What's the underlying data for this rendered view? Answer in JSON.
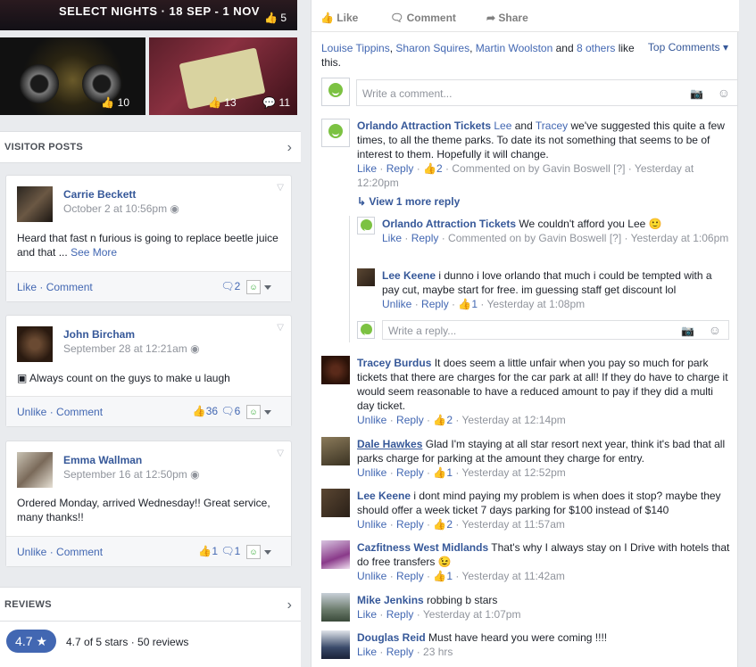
{
  "banner": {
    "text": "SELECT NIGHTS · 18 SEP - 1 NOV",
    "likes": "5"
  },
  "photos": [
    {
      "likes": "10"
    },
    {
      "likes": "13",
      "comments": "11"
    }
  ],
  "visitor_posts": {
    "title": "VISITOR POSTS",
    "posts": [
      {
        "name": "Carrie Beckett",
        "date": "October 2 at 10:56pm",
        "text": "Heard that fast n furious is going to replace beetle juice and that ...",
        "see_more": "See More",
        "actions": [
          "Like",
          "Comment"
        ],
        "likes": "",
        "comments": "2"
      },
      {
        "name": "John Bircham",
        "date": "September 28 at 12:21am",
        "text": "Always count on the guys to make u laugh",
        "actions": [
          "Unlike",
          "Comment"
        ],
        "likes": "36",
        "comments": "6"
      },
      {
        "name": "Emma Wallman",
        "date": "September 16 at 12:50pm",
        "text": "Ordered Monday, arrived Wednesday!! Great service, many thanks!!",
        "actions": [
          "Unlike",
          "Comment"
        ],
        "likes": "1",
        "comments": "1"
      }
    ]
  },
  "reviews": {
    "title": "REVIEWS",
    "rating": "4.7 ★",
    "summary": "4.7 of 5 stars · 50 reviews"
  },
  "action_bar": {
    "like": "Like",
    "comment": "Comment",
    "share": "Share"
  },
  "likers": {
    "names": [
      "Louise Tippins",
      "Sharon Squires",
      "Martin Woolston"
    ],
    "and": "and",
    "others": "8 others",
    "suffix": "like this."
  },
  "sort": "Top Comments",
  "write_comment": {
    "placeholder": "Write a comment..."
  },
  "write_reply": {
    "placeholder": "Write a reply..."
  },
  "comments": [
    {
      "name": "Orlando Attraction Tickets",
      "tags": [
        "Lee",
        "Tracey"
      ],
      "and": "and",
      "text": "we've suggested this quite a few times, to all the theme parks. To date its not something that seems to be of interest to them. Hopefully it will change.",
      "actions": [
        "Like",
        "Reply"
      ],
      "likes": "2",
      "by": "Commented on by Gavin Boswell",
      "q": "[?]",
      "time": "Yesterday at 12:20pm"
    },
    {
      "view_more": "View 1 more reply"
    },
    {
      "name": "Orlando Attraction Tickets",
      "text": "We couldn't afford you Lee",
      "emoji": "🙂",
      "actions": [
        "Like",
        "Reply"
      ],
      "by": "Commented on by Gavin Boswell",
      "q": "[?]",
      "time": "Yesterday at 1:06pm"
    },
    {
      "name": "Lee Keene",
      "text": "i dunno i love orlando that much i could be tempted with a pay cut, maybe start for free. im guessing staff get discount lol",
      "actions": [
        "Unlike",
        "Reply"
      ],
      "likes": "1",
      "time": "Yesterday at 1:08pm"
    },
    {
      "name": "Tracey Burdus",
      "text": "It does seem a little unfair when you pay so much for park tickets that there are charges for the car park at all! If they do have to charge it would seem reasonable to have a reduced amount to pay if they did a multi day ticket.",
      "actions": [
        "Unlike",
        "Reply"
      ],
      "likes": "2",
      "time": "Yesterday at 12:14pm"
    },
    {
      "name": "Dale Hawkes",
      "text": "Glad I'm staying at all star resort next year, think it's bad that all parks charge for parking at the amount they charge for entry.",
      "actions": [
        "Unlike",
        "Reply"
      ],
      "likes": "1",
      "time": "Yesterday at 12:52pm"
    },
    {
      "name": "Lee Keene",
      "text": "i dont mind paying my problem is when does it stop? maybe they should offer a week ticket 7 days parking for $100 instead of $140",
      "actions": [
        "Unlike",
        "Reply"
      ],
      "likes": "2",
      "time": "Yesterday at 11:57am"
    },
    {
      "name": "Cazfitness West Midlands",
      "text": "That's why I always stay on I Drive with hotels that do free transfers",
      "emoji": "😉",
      "actions": [
        "Unlike",
        "Reply"
      ],
      "likes": "1",
      "time": "Yesterday at 11:42am"
    },
    {
      "name": "Mike Jenkins",
      "text": "robbing b stars",
      "actions": [
        "Like",
        "Reply"
      ],
      "time": "Yesterday at 1:07pm"
    },
    {
      "name": "Douglas Reid",
      "text": "Must have heard you were coming !!!!",
      "actions": [
        "Like",
        "Reply"
      ],
      "time": "23 hrs"
    }
  ],
  "colors": {
    "link": "#365899",
    "action": "#4267b2",
    "muted": "#90949c",
    "page_bg": "#e9ebee",
    "logo_green": "#7cc242"
  }
}
